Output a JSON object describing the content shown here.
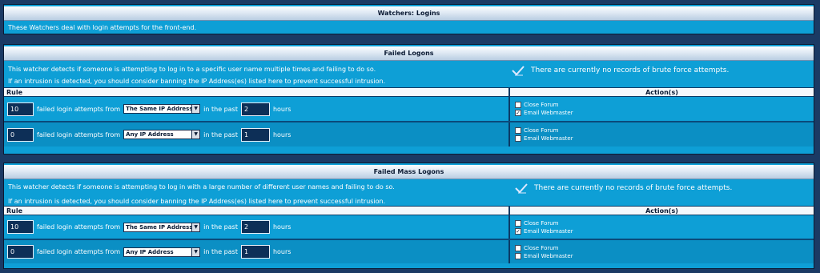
{
  "watchers": {
    "title": "Watchers: Logins",
    "description": "These Watchers deal with login attempts for the front-end."
  },
  "failed_logons": {
    "title": "Failed Logons",
    "desc_line1": "This watcher detects if someone is attempting to log in to a specific user name multiple times and failing to do so.",
    "desc_line2": "If an intrusion is detected, you should consider banning the IP Address(es) listed here to prevent successful intrusion.",
    "status": "There are currently no records of brute force attempts.",
    "col_rule": "Rule",
    "col_actions": "Action(s)",
    "rows": [
      {
        "attempts": "10",
        "source": "The Same IP Address",
        "period": "2",
        "close_forum": "Close Forum",
        "close_forum_checked": false,
        "email_webmaster": "Email Webmaster",
        "email_checked": true
      },
      {
        "attempts": "0",
        "source": "Any IP Address",
        "period": "1",
        "close_forum": "Close Forum",
        "close_forum_checked": false,
        "email_webmaster": "Email Webmaster",
        "email_checked": false
      }
    ]
  },
  "failed_mass_logons": {
    "title": "Failed Mass Logons",
    "desc_line1": "This watcher detects if someone is attempting to log in with a large number of different user names and failing to do so.",
    "desc_line2": "If an intrusion is detected, you should consider banning the IP Address(es) listed here to prevent successful intrusion.",
    "status": "There are currently no records of brute force attempts.",
    "col_rule": "Rule",
    "col_actions": "Action(s)",
    "rows": [
      {
        "attempts": "10",
        "source": "The Same IP Address",
        "period": "2",
        "close_forum": "Close Forum",
        "close_forum_checked": false,
        "email_webmaster": "Email Webmaster",
        "email_checked": true
      },
      {
        "attempts": "0",
        "source": "Any IP Address",
        "period": "1",
        "close_forum": "Close Forum",
        "close_forum_checked": false,
        "email_webmaster": "Email Webmaster",
        "email_checked": false
      }
    ]
  },
  "labels": {
    "failed_from": "failed login attempts from",
    "in_past": "in the past",
    "hours": "hours"
  },
  "icons": {
    "status_icon": "check-arrow-icon",
    "dropdown_icon": "triangle-down-icon"
  },
  "colors": {
    "background": "#1b3a64",
    "panel": "#0e9fd6",
    "panel_alt": "#0b8fc4"
  }
}
